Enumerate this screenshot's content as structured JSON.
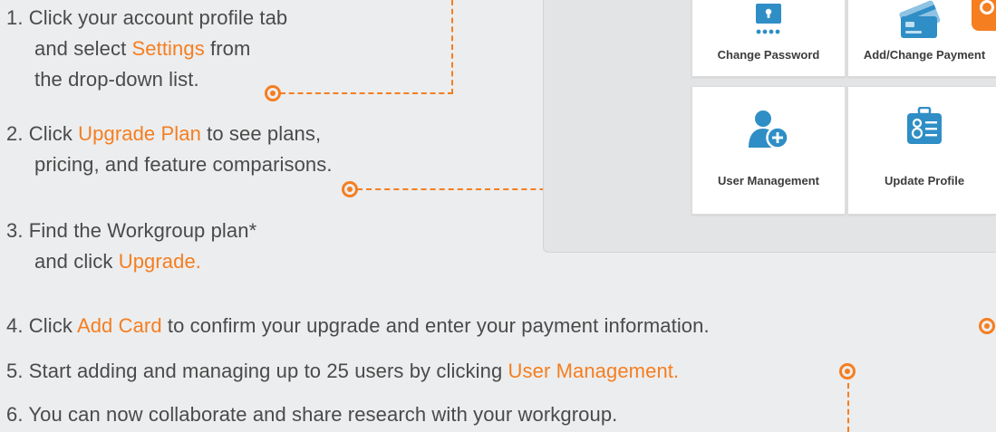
{
  "steps": [
    {
      "num": "1.",
      "line1": "Click your account profile tab",
      "line2_pre": "and select ",
      "line2_hl": "Settings",
      "line2_post": " from",
      "line3": "the drop-down list."
    },
    {
      "num": "2.",
      "line1_pre": "Click ",
      "line1_hl": "Upgrade Plan",
      "line1_post": " to see plans,",
      "line2": "pricing, and feature comparisons."
    },
    {
      "num": "3.",
      "line1": "Find the Workgroup plan*",
      "line2_pre": "and click ",
      "line2_hl": "Upgrade."
    },
    {
      "num": "4.",
      "pre": "Click ",
      "hl": "Add Card",
      "post": " to confirm your upgrade and enter your payment information."
    },
    {
      "num": "5.",
      "pre": "Start adding and managing up to 25 users by clicking ",
      "hl": "User Management."
    },
    {
      "num": "6.",
      "text": "You can now collaborate and share research with your workgroup."
    }
  ],
  "settings_tiles": [
    {
      "label": "Change Password",
      "icon": "lock-password-icon"
    },
    {
      "label": "Add/Change Payment",
      "icon": "credit-card-icon"
    },
    {
      "label": "User Management",
      "icon": "add-user-icon"
    },
    {
      "label": "Update Profile",
      "icon": "profile-card-icon"
    }
  ],
  "colors": {
    "accent": "#f57e20",
    "icon_blue": "#2f8ec6",
    "text": "#4a4a4a",
    "background": "#ecedee"
  }
}
